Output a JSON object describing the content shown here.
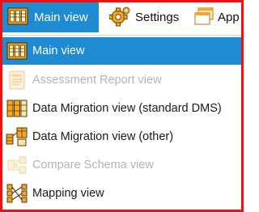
{
  "toolbar": {
    "main_view_label": "Main view",
    "settings_label": "Settings",
    "app_label": "App"
  },
  "menu": {
    "items": [
      {
        "label": "Main view",
        "state": "selected",
        "icon": "main-view-icon"
      },
      {
        "label": "Assessment Report view",
        "state": "disabled",
        "icon": "assessment-report-icon"
      },
      {
        "label": "Data Migration view (standard DMS)",
        "state": "enabled",
        "icon": "data-migration-standard-icon"
      },
      {
        "label": "Data Migration view (other)",
        "state": "enabled",
        "icon": "data-migration-other-icon"
      },
      {
        "label": "Compare Schema view",
        "state": "disabled",
        "icon": "compare-schema-icon"
      },
      {
        "label": "Mapping view",
        "state": "enabled",
        "icon": "mapping-view-icon"
      }
    ]
  },
  "colors": {
    "accent": "#1e8bd3",
    "frame_border": "#ee1111",
    "icon_orange": "#f5a623",
    "disabled_text": "#b4b4b4"
  }
}
